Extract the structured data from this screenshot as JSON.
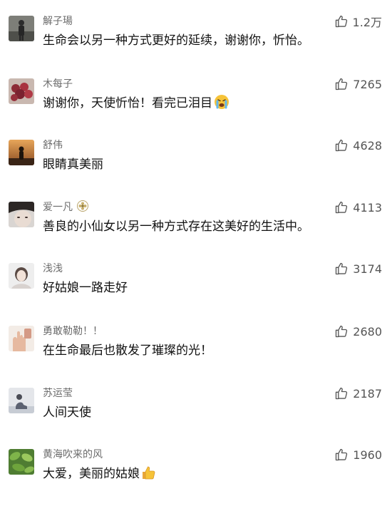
{
  "comments": [
    {
      "nickname": "解子瑒",
      "text": "生命会以另一种方式更好的延续，谢谢你，忻怡。",
      "likes": "1.2万",
      "avatar": "person-standing-avatar"
    },
    {
      "nickname": "木每子",
      "text": "谢谢你，天使忻怡！看完已泪目",
      "likes": "7265",
      "avatar": "flowers-avatar",
      "emoji": "crying-face-emoji"
    },
    {
      "nickname": "舒伟",
      "text": "眼睛真美丽",
      "likes": "4628",
      "avatar": "sunset-silhouette-avatar"
    },
    {
      "nickname": "爱一凡",
      "text": "善良的小仙女以另一种方式存在这美好的生活中。",
      "likes": "4113",
      "avatar": "face-closeup-avatar",
      "badge": "flower-badge-icon"
    },
    {
      "nickname": "浅浅",
      "text": "好姑娘一路走好",
      "likes": "3174",
      "avatar": "girl-portrait-avatar"
    },
    {
      "nickname": "勇敢勒勒！！",
      "text": "在生命最后也散发了璀璨的光！",
      "likes": "2680",
      "avatar": "hand-gesture-avatar"
    },
    {
      "nickname": "苏运莹",
      "text": "人间天使",
      "likes": "2187",
      "avatar": "person-sitting-avatar"
    },
    {
      "nickname": "黄海吹来的风",
      "text": "大爱，美丽的姑娘",
      "likes": "1960",
      "avatar": "green-leaves-avatar",
      "emoji": "thumbs-up-emoji"
    }
  ],
  "colors": {
    "nickname": "#6b6b6b",
    "text": "#111111",
    "like": "#555555",
    "background": "#ffffff"
  }
}
